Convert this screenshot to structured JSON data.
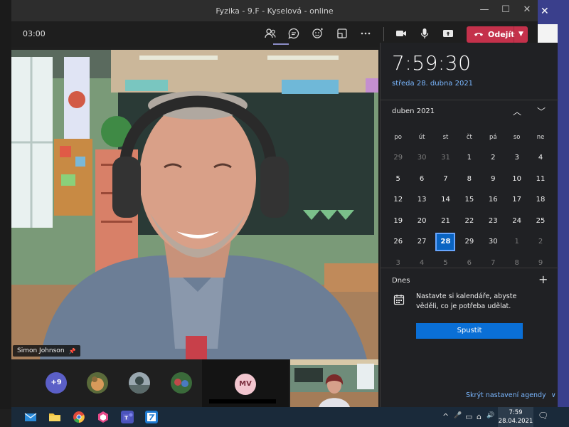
{
  "window": {
    "title": "Fyzika - 9.F - Kyselová - online",
    "minimize": "—",
    "maximize": "☐",
    "close": "✕",
    "outer_close": "✕"
  },
  "toolbar": {
    "timer": "03:00",
    "leave_label": "Odejít",
    "leave_dropdown": "▼",
    "icons": [
      "people-icon",
      "chat-icon",
      "reactions-icon",
      "rooms-icon",
      "more-icon",
      "camera-icon",
      "mic-icon",
      "share-icon"
    ]
  },
  "video": {
    "main_participant": "Simon Johnson",
    "pin_icon": "📌"
  },
  "participants": {
    "more_count": "+9",
    "mv_initials": "MV"
  },
  "calendar": {
    "clock": "7:59:30",
    "date_long": "středa 28. dubna 2021",
    "month_label": "duben 2021",
    "prev": "︿",
    "next": "﹀",
    "weekdays": [
      "po",
      "út",
      "st",
      "čt",
      "pá",
      "so",
      "ne"
    ],
    "weeks": [
      [
        "29",
        "30",
        "31",
        "1",
        "2",
        "3",
        "4"
      ],
      [
        "5",
        "6",
        "7",
        "8",
        "9",
        "10",
        "11"
      ],
      [
        "12",
        "13",
        "14",
        "15",
        "16",
        "17",
        "18"
      ],
      [
        "19",
        "20",
        "21",
        "22",
        "23",
        "24",
        "25"
      ],
      [
        "26",
        "27",
        "28",
        "29",
        "30",
        "1",
        "2"
      ],
      [
        "3",
        "4",
        "5",
        "6",
        "7",
        "8",
        "9"
      ]
    ],
    "today_section": "Dnes",
    "add": "+",
    "agenda_message": "Nastavte si kalendáře, abyste věděli, co je potřeba udělat.",
    "start_button": "Spustit",
    "hide_agenda": "Skrýt nastavení agendy",
    "hide_agenda_chevron": "∨"
  },
  "taskbar": {
    "time": "7:59",
    "date": "28.04.2021",
    "tray_symbols": {
      "chevron": "^",
      "mic": "🎤",
      "battery": "▭",
      "network": "⌂",
      "volume": "🔊"
    },
    "notification": "🗨",
    "apps": [
      "mail-icon",
      "file-explorer-icon",
      "chrome-icon",
      "app-icon",
      "teams-icon",
      "notes-icon"
    ]
  }
}
